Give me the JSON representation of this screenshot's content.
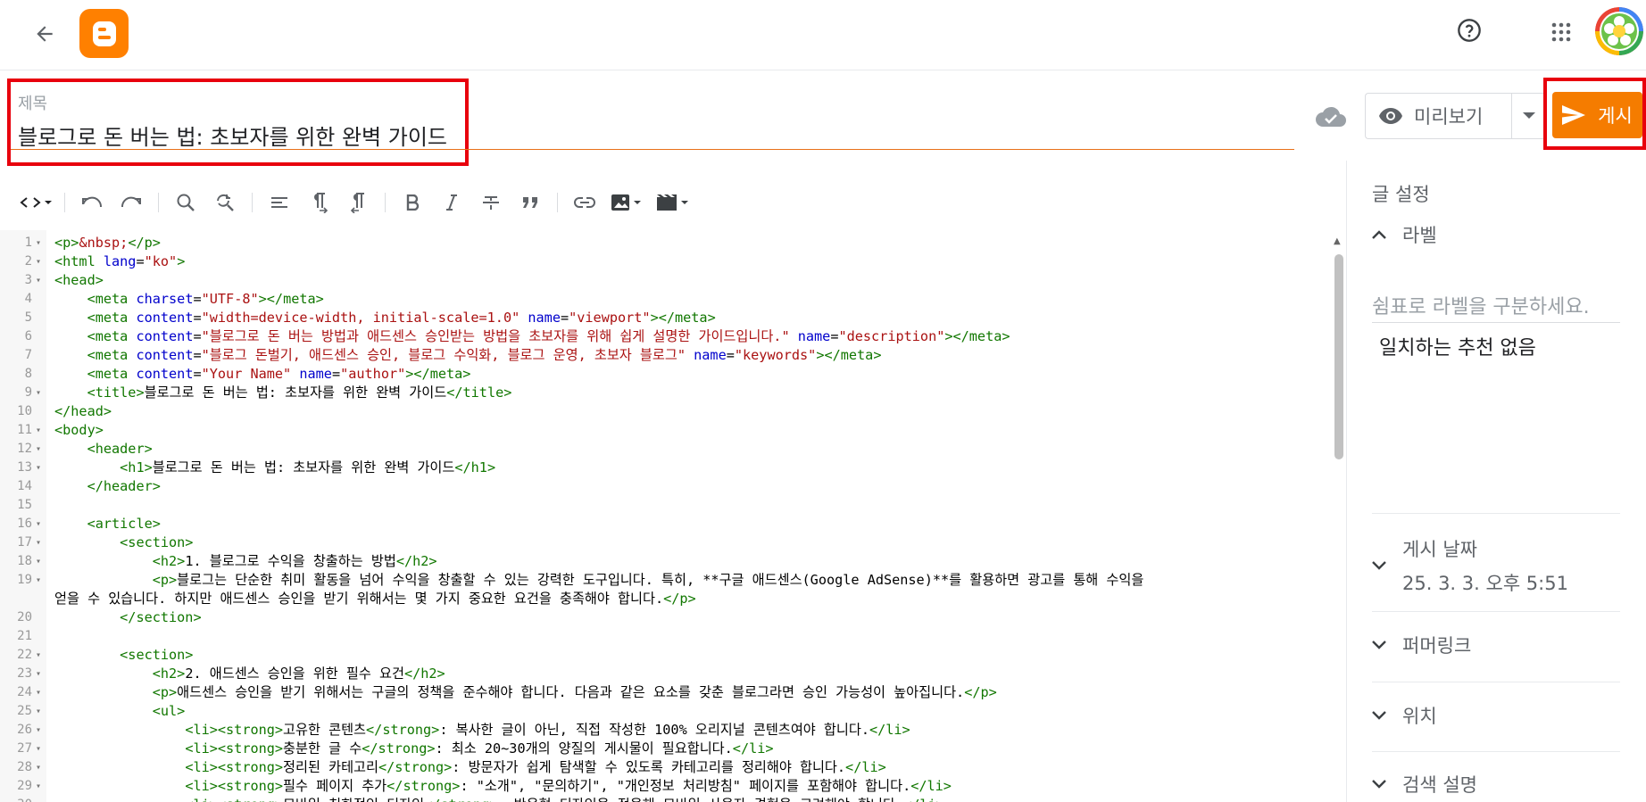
{
  "topbar": {
    "back_icon": "arrow-left-icon",
    "logo_icon": "blogger-logo-icon",
    "help_icon": "help-circle-icon",
    "apps_icon": "apps-grid-icon",
    "brand_color": "#ff8000"
  },
  "title": {
    "label": "제목",
    "value": "블로그로 돈 버는 법: 초보자를 위한 완벽 가이드"
  },
  "actions": {
    "preview_label": "미리보기",
    "publish_label": "게시",
    "publish_color": "#f57c00"
  },
  "editor": {
    "lines": [
      {
        "n": "1",
        "fold": "▾",
        "html": "<span class=\"tag\">&lt;p&gt;</span><span class=\"str\">&amp;nbsp;</span><span class=\"tag\">&lt;/p&gt;</span>"
      },
      {
        "n": "2",
        "fold": "▾",
        "html": "<span class=\"tag\">&lt;html</span> <span class=\"attr\">lang</span>=<span class=\"str\">\"ko\"</span><span class=\"tag\">&gt;</span>"
      },
      {
        "n": "3",
        "fold": "▾",
        "html": "<span class=\"tag\">&lt;head&gt;</span>"
      },
      {
        "n": "4",
        "fold": "",
        "html": "    <span class=\"tag\">&lt;meta</span> <span class=\"attr\">charset</span>=<span class=\"str\">\"UTF-8\"</span><span class=\"tag\">&gt;&lt;/meta&gt;</span>"
      },
      {
        "n": "5",
        "fold": "",
        "html": "    <span class=\"tag\">&lt;meta</span> <span class=\"attr\">content</span>=<span class=\"str\">\"width=device-width, initial-scale=1.0\"</span> <span class=\"attr\">name</span>=<span class=\"str\">\"viewport\"</span><span class=\"tag\">&gt;&lt;/meta&gt;</span>"
      },
      {
        "n": "6",
        "fold": "",
        "html": "    <span class=\"tag\">&lt;meta</span> <span class=\"attr\">content</span>=<span class=\"str\">\"블로그로 돈 버는 방법과 애드센스 승인받는 방법을 초보자를 위해 쉽게 설명한 가이드입니다.\"</span> <span class=\"attr\">name</span>=<span class=\"str\">\"description\"</span><span class=\"tag\">&gt;&lt;/meta&gt;</span>"
      },
      {
        "n": "7",
        "fold": "",
        "html": "    <span class=\"tag\">&lt;meta</span> <span class=\"attr\">content</span>=<span class=\"str\">\"블로그 돈벌기, 애드센스 승인, 블로그 수익화, 블로그 운영, 초보자 블로그\"</span> <span class=\"attr\">name</span>=<span class=\"str\">\"keywords\"</span><span class=\"tag\">&gt;&lt;/meta&gt;</span>"
      },
      {
        "n": "8",
        "fold": "",
        "html": "    <span class=\"tag\">&lt;meta</span> <span class=\"attr\">content</span>=<span class=\"str\">\"Your Name\"</span> <span class=\"attr\">name</span>=<span class=\"str\">\"author\"</span><span class=\"tag\">&gt;&lt;/meta&gt;</span>"
      },
      {
        "n": "9",
        "fold": "▾",
        "html": "    <span class=\"tag\">&lt;title&gt;</span>블로그로 돈 버는 법: 초보자를 위한 완벽 가이드<span class=\"tag\">&lt;/title&gt;</span>"
      },
      {
        "n": "10",
        "fold": "",
        "html": "<span class=\"tag\">&lt;/head&gt;</span>"
      },
      {
        "n": "11",
        "fold": "▾",
        "html": "<span class=\"tag\">&lt;body&gt;</span>"
      },
      {
        "n": "12",
        "fold": "▾",
        "html": "    <span class=\"tag\">&lt;header&gt;</span>"
      },
      {
        "n": "13",
        "fold": "▾",
        "html": "        <span class=\"tag\">&lt;h1&gt;</span>블로그로 돈 버는 법: 초보자를 위한 완벽 가이드<span class=\"tag\">&lt;/h1&gt;</span>"
      },
      {
        "n": "14",
        "fold": "",
        "html": "    <span class=\"tag\">&lt;/header&gt;</span>"
      },
      {
        "n": "15",
        "fold": "",
        "html": ""
      },
      {
        "n": "16",
        "fold": "▾",
        "html": "    <span class=\"tag\">&lt;article&gt;</span>"
      },
      {
        "n": "17",
        "fold": "▾",
        "html": "        <span class=\"tag\">&lt;section&gt;</span>"
      },
      {
        "n": "18",
        "fold": "▾",
        "html": "            <span class=\"tag\">&lt;h2&gt;</span>1. 블로그로 수익을 창출하는 방법<span class=\"tag\">&lt;/h2&gt;</span>"
      },
      {
        "n": "19",
        "fold": "▾",
        "html": "            <span class=\"tag\">&lt;p&gt;</span>블로그는 단순한 취미 활동을 넘어 수익을 창출할 수 있는 강력한 도구입니다. 특히, **구글 애드센스(Google AdSense)**를 활용하면 광고를 통해 수익을"
      },
      {
        "n": "",
        "fold": "",
        "html": "얻을 수 있습니다. 하지만 애드센스 승인을 받기 위해서는 몇 가지 중요한 요건을 충족해야 합니다.<span class=\"tag\">&lt;/p&gt;</span>"
      },
      {
        "n": "20",
        "fold": "",
        "html": "        <span class=\"tag\">&lt;/section&gt;</span>"
      },
      {
        "n": "21",
        "fold": "",
        "html": ""
      },
      {
        "n": "22",
        "fold": "▾",
        "html": "        <span class=\"tag\">&lt;section&gt;</span>"
      },
      {
        "n": "23",
        "fold": "▾",
        "html": "            <span class=\"tag\">&lt;h2&gt;</span>2. 애드센스 승인을 위한 필수 요건<span class=\"tag\">&lt;/h2&gt;</span>"
      },
      {
        "n": "24",
        "fold": "▾",
        "html": "            <span class=\"tag\">&lt;p&gt;</span>애드센스 승인을 받기 위해서는 구글의 정책을 준수해야 합니다. 다음과 같은 요소를 갖춘 블로그라면 승인 가능성이 높아집니다.<span class=\"tag\">&lt;/p&gt;</span>"
      },
      {
        "n": "25",
        "fold": "▾",
        "html": "            <span class=\"tag\">&lt;ul&gt;</span>"
      },
      {
        "n": "26",
        "fold": "▾",
        "html": "                <span class=\"tag\">&lt;li&gt;&lt;strong&gt;</span>고유한 콘텐츠<span class=\"tag\">&lt;/strong&gt;</span>: 복사한 글이 아닌, 직접 작성한 100% 오리지널 콘텐츠여야 합니다.<span class=\"tag\">&lt;/li&gt;</span>"
      },
      {
        "n": "27",
        "fold": "▾",
        "html": "                <span class=\"tag\">&lt;li&gt;&lt;strong&gt;</span>충분한 글 수<span class=\"tag\">&lt;/strong&gt;</span>: 최소 20~30개의 양질의 게시물이 필요합니다.<span class=\"tag\">&lt;/li&gt;</span>"
      },
      {
        "n": "28",
        "fold": "▾",
        "html": "                <span class=\"tag\">&lt;li&gt;&lt;strong&gt;</span>정리된 카테고리<span class=\"tag\">&lt;/strong&gt;</span>: 방문자가 쉽게 탐색할 수 있도록 카테고리를 정리해야 합니다.<span class=\"tag\">&lt;/li&gt;</span>"
      },
      {
        "n": "29",
        "fold": "▾",
        "html": "                <span class=\"tag\">&lt;li&gt;&lt;strong&gt;</span>필수 페이지 추가<span class=\"tag\">&lt;/strong&gt;</span>: \"소개\", \"문의하기\", \"개인정보 처리방침\" 페이지를 포함해야 합니다.<span class=\"tag\">&lt;/li&gt;</span>"
      },
      {
        "n": "30",
        "fold": "▾",
        "html": "                <span class=\"tag\">&lt;li&gt;&lt;strong&gt;</span>모바일 친화적인 디자인<span class=\"tag\">&lt;/strong&gt;</span>: 반응형 디자인을 적용해 모바일 사용자 경험을 고려해야 합니다.<span class=\"tag\">&lt;/li&gt;</span>"
      }
    ]
  },
  "panel": {
    "title": "글 설정",
    "labels_heading": "라벨",
    "labels_placeholder": "쉼표로 라벨을 구분하세요.",
    "labels_no_match": "일치하는 추천 없음",
    "publish_date_heading": "게시 날짜",
    "publish_date_value": "25. 3. 3. 오후 5:51",
    "permalink_heading": "퍼머링크",
    "location_heading": "위치",
    "search_desc_heading": "검색 설명"
  }
}
